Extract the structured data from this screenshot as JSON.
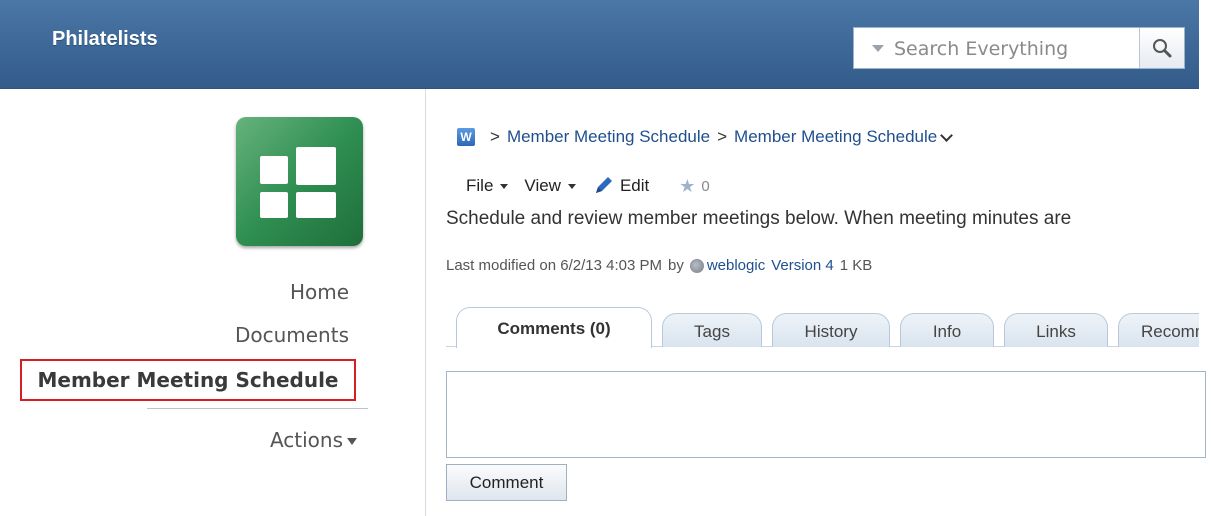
{
  "header": {
    "app_title": "Philatelists",
    "search": {
      "placeholder": "Search Everything"
    }
  },
  "sidebar": {
    "items": [
      {
        "label": "Home"
      },
      {
        "label": "Documents"
      },
      {
        "label": "Member Meeting Schedule",
        "selected": true
      },
      {
        "label": "Actions"
      }
    ]
  },
  "breadcrumb": {
    "icon_letter": "W",
    "separator": ">",
    "items": [
      "Member Meeting Schedule",
      "Member Meeting Schedule"
    ]
  },
  "toolbar": {
    "file_label": "File",
    "view_label": "View",
    "edit_label": "Edit",
    "like_count": "0"
  },
  "page": {
    "description": "Schedule and review member meetings below.  When meeting minutes are",
    "meta": {
      "last_modified_text": "Last modified on 6/2/13 4:03 PM",
      "by_text": "by",
      "user": "weblogic",
      "version": "Version 4",
      "size": "1 KB"
    }
  },
  "tabs": [
    {
      "label": "Comments (0)",
      "active": true
    },
    {
      "label": "Tags"
    },
    {
      "label": "History"
    },
    {
      "label": "Info"
    },
    {
      "label": "Links"
    },
    {
      "label": "Recomm"
    }
  ],
  "comment": {
    "button_label": "Comment"
  },
  "colors": {
    "header_blue": "#3c6797",
    "link_blue": "#1f4f8f",
    "selection_red": "#d41f25",
    "space_icon_green": "#2f8f52"
  }
}
